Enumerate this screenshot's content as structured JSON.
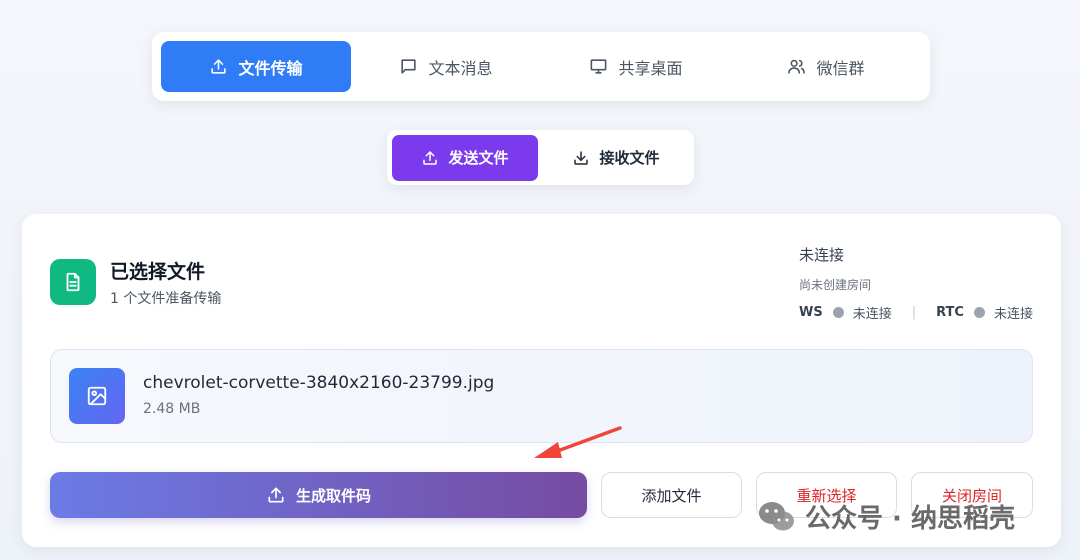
{
  "main_tabs": [
    {
      "label": "文件传输",
      "icon": "upload-icon",
      "active": true
    },
    {
      "label": "文本消息",
      "icon": "message-icon",
      "active": false
    },
    {
      "label": "共享桌面",
      "icon": "monitor-icon",
      "active": false
    },
    {
      "label": "微信群",
      "icon": "users-icon",
      "active": false
    }
  ],
  "sub_tabs": [
    {
      "label": "发送文件",
      "icon": "upload-icon",
      "active": true
    },
    {
      "label": "接收文件",
      "icon": "download-icon",
      "active": false
    }
  ],
  "card": {
    "title": "已选择文件",
    "subtitle": "1 个文件准备传输",
    "connection_status": "未连接",
    "room_status": "尚未创建房间",
    "ws_label": "WS",
    "ws_status": "未连接",
    "rtc_label": "RTC",
    "rtc_status": "未连接",
    "separator": "|"
  },
  "file": {
    "name": "chevrolet-corvette-3840x2160-23799.jpg",
    "size": "2.48 MB"
  },
  "buttons": {
    "generate": "生成取件码",
    "add": "添加文件",
    "reselect": "重新选择",
    "close_room": "关闭房间"
  },
  "watermark": {
    "text": "公众号 · 纳思稻壳"
  },
  "colors": {
    "primary_blue": "#2f7cf6",
    "purple": "#7c3aed",
    "green": "#10b981",
    "danger": "#dc2626",
    "arrow": "#f0453a"
  }
}
